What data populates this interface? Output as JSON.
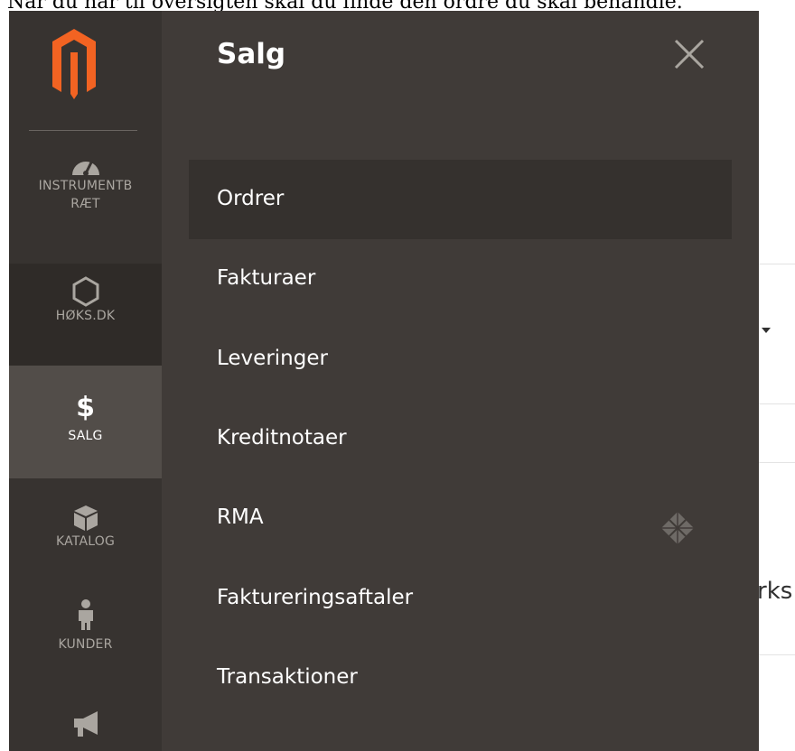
{
  "caption": "Når du når til oversigten skal du finde den ordre du skal behandle.",
  "background": {
    "partial_text": "rks"
  },
  "sidebar": {
    "logo": "magento-logo",
    "items": [
      {
        "label": "INSTRUMENTB",
        "label2": "RÆT",
        "icon": "dashboard-icon"
      },
      {
        "label": "HØKS.DK",
        "icon": "hexagon-icon"
      },
      {
        "label": "SALG",
        "icon": "dollar-icon",
        "symbol": "$",
        "active": true
      },
      {
        "label": "KATALOG",
        "icon": "box-icon"
      },
      {
        "label": "KUNDER",
        "icon": "person-icon"
      },
      {
        "label": "",
        "icon": "megaphone-icon"
      }
    ]
  },
  "panel": {
    "title": "Salg",
    "close_icon": "close-icon",
    "items": [
      {
        "label": "Ordrer",
        "active": true
      },
      {
        "label": "Fakturaer"
      },
      {
        "label": "Leveringer"
      },
      {
        "label": "Kreditnotaer"
      },
      {
        "label": "RMA",
        "icon": "diamond-pattern-icon"
      },
      {
        "label": "Faktureringsaftaler"
      },
      {
        "label": "Transaktioner"
      }
    ]
  },
  "colors": {
    "sidebar_bg": "#373330",
    "sidebar_active": "#524d49",
    "panel_bg": "#403b38",
    "logo_orange": "#f26322"
  }
}
